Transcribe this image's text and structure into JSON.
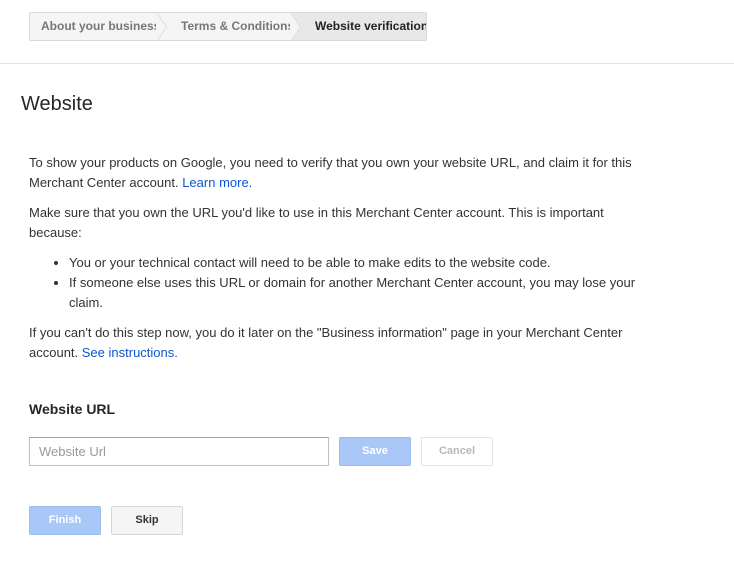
{
  "breadcrumb": {
    "steps": [
      {
        "label": "About your business"
      },
      {
        "label": "Terms & Conditions"
      },
      {
        "label": "Website verification"
      }
    ]
  },
  "page": {
    "title": "Website"
  },
  "intro": {
    "p1_text": "To show your products on Google, you need to verify that you own your website URL, and claim it for this Merchant Center account. ",
    "p1_link": "Learn more.",
    "p2_text": "Make sure that you own the URL you'd like to use in this Merchant Center account. This is important because:",
    "bullets": [
      "You or your technical contact will need to be able to make edits to the website code.",
      "If someone else uses this URL or domain for another Merchant Center account, you may lose your claim."
    ],
    "p3_text": "If you can't do this step now, you do it later on the \"Business information\" page in your Merchant Center account. ",
    "p3_link": "See instructions."
  },
  "url_form": {
    "label": "Website URL",
    "input_value": "",
    "input_placeholder": "Website Url",
    "save_label": "Save",
    "cancel_label": "Cancel"
  },
  "footer": {
    "finish_label": "Finish",
    "skip_label": "Skip"
  },
  "colors": {
    "link": "#1155cc",
    "primary_disabled": "#a9c8f7"
  }
}
